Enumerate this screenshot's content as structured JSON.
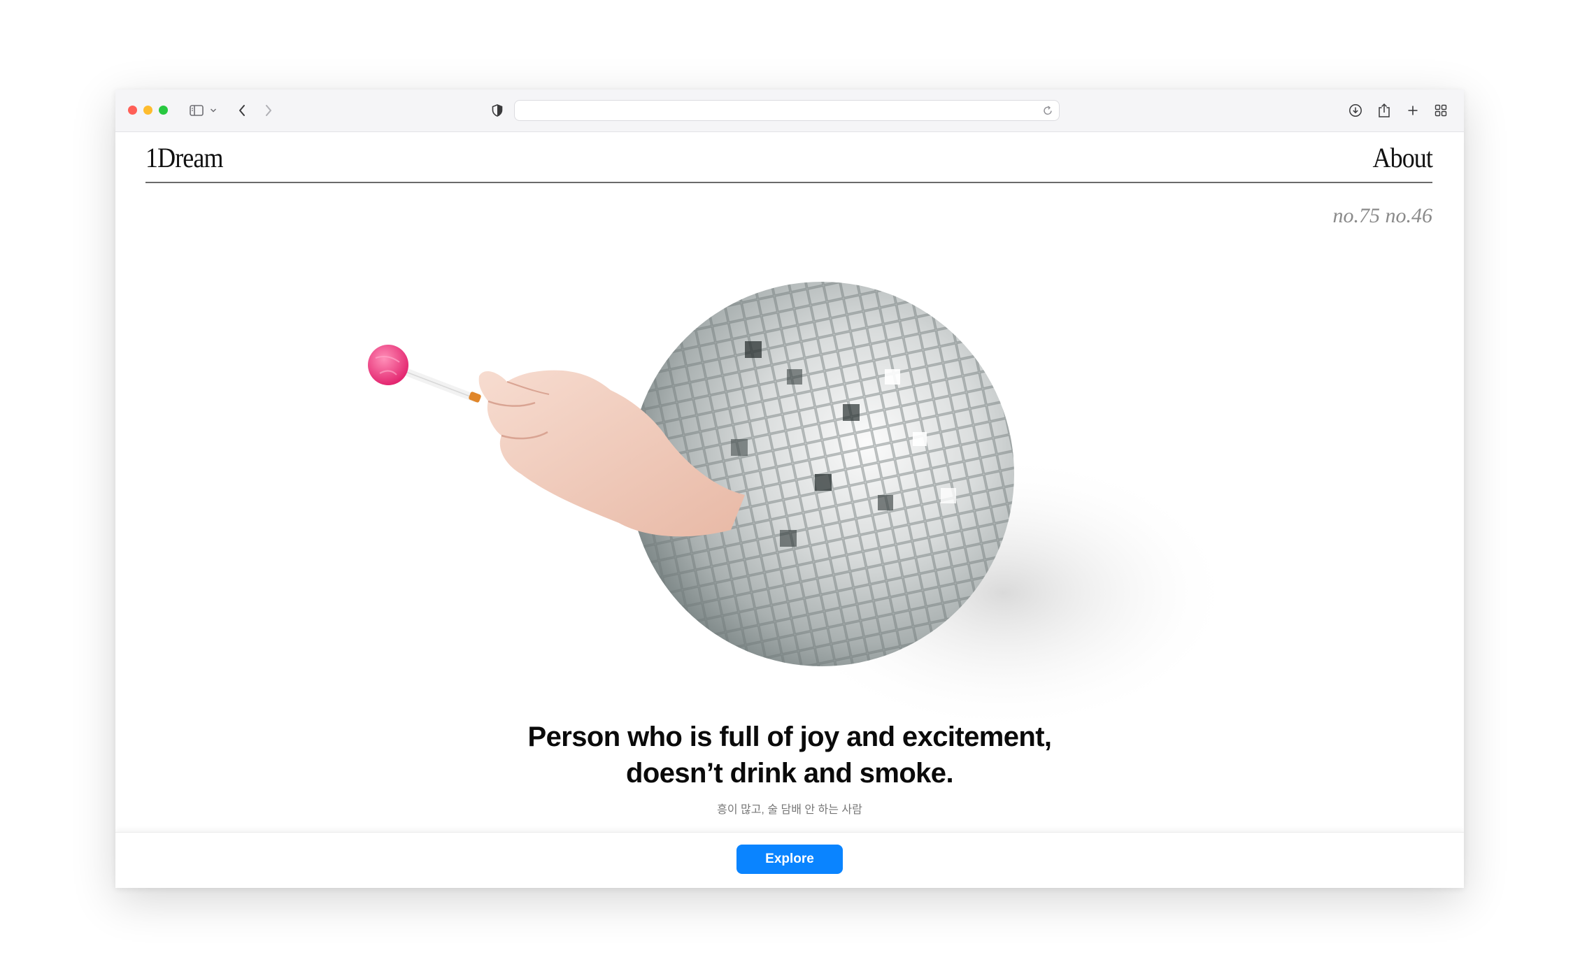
{
  "browser": {
    "address": "",
    "icons": {
      "sidebar": "sidebar-icon",
      "chevron": "chevron-down-icon",
      "back": "back-arrow-icon",
      "forward": "forward-arrow-icon",
      "privacy": "shield-icon",
      "reload": "reload-icon",
      "download": "download-icon",
      "share": "share-icon",
      "new_tab": "plus-icon",
      "tabs": "tab-overview-icon"
    },
    "traffic_lights": {
      "close": "#ff5f57",
      "minimize": "#febc2e",
      "zoom": "#28c840"
    }
  },
  "site": {
    "logo": "1Dream",
    "nav": {
      "about": "About"
    },
    "issue_numbers": "no.75 no.46"
  },
  "hero": {
    "image_subject": "hand holding a pink lollipop emerging from a mirrored disco ball",
    "headline_line1": "Person who is full of joy and excitement,",
    "headline_line2": "doesn’t drink and smoke.",
    "subhead": "흥이 많고, 술 담배 안 하는 사람"
  },
  "footer": {
    "explore_label": "Explore",
    "accent_color": "#0a84ff"
  }
}
